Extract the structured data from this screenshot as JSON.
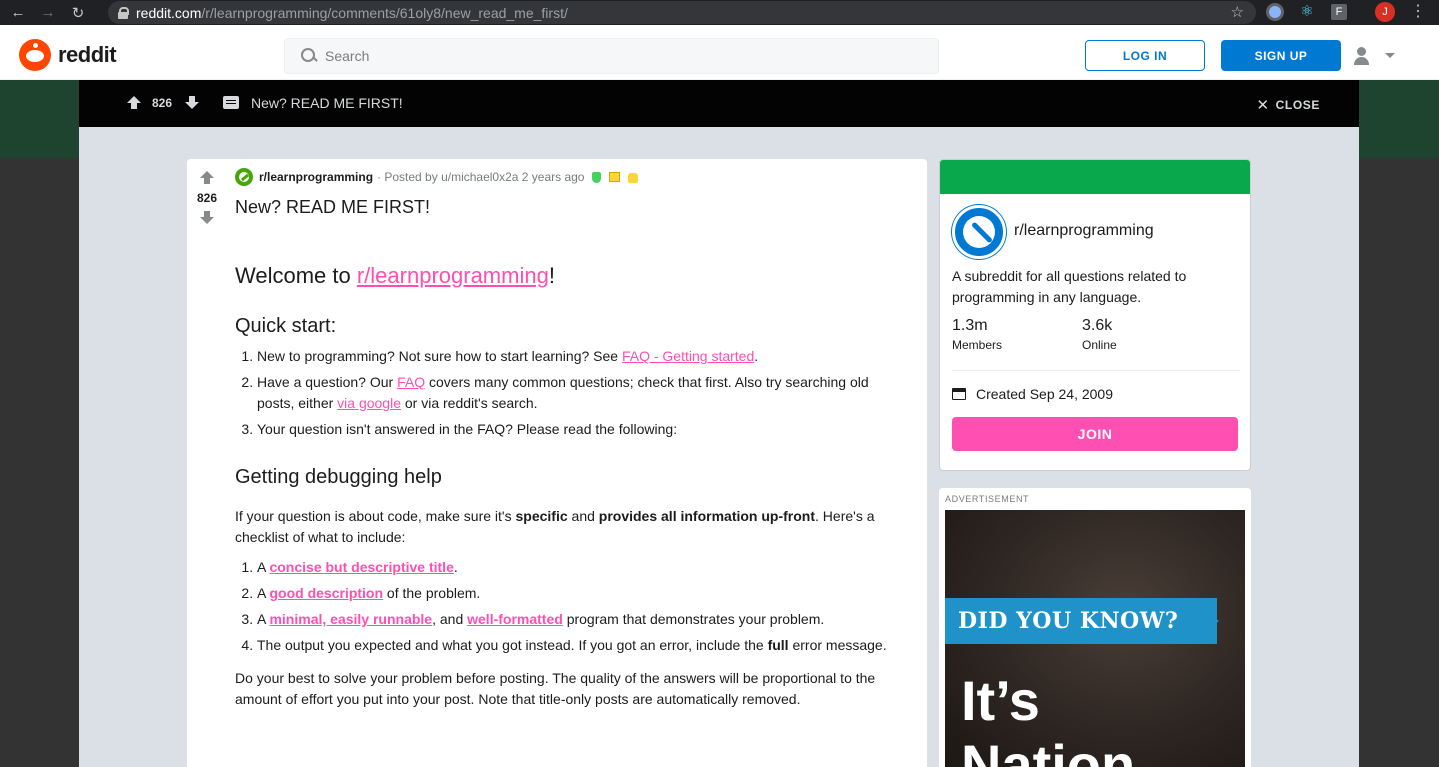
{
  "browser": {
    "url_host": "reddit.com",
    "url_path": "/r/learnprogramming/comments/61oly8/new_read_me_first/",
    "profile_initial": "J",
    "ext_f": "F"
  },
  "header": {
    "logo_text": "reddit",
    "search_placeholder": "Search",
    "login_label": "LOG IN",
    "signup_label": "SIGN UP"
  },
  "topbar": {
    "vote_count": "826",
    "title": "New? READ ME FIRST!",
    "close_label": "CLOSE"
  },
  "post": {
    "vote_count": "826",
    "subreddit": "r/learnprogramming",
    "posted_by": "· Posted by u/michael0x2a 2 years ago",
    "title": "New? READ ME FIRST!",
    "welcome_prefix": "Welcome to ",
    "welcome_link": "r/learnprogramming",
    "welcome_suffix": "!",
    "quick_start_heading": "Quick start:",
    "qs1_text": "New to programming? Not sure how to start learning? See ",
    "qs1_link": "FAQ - Getting started",
    "qs1_end": ".",
    "qs2_text": "Have a question? Our ",
    "qs2_link1": "FAQ",
    "qs2_mid": " covers many common questions; check that first. Also try searching old posts, either ",
    "qs2_link2": "via google",
    "qs2_end": " or via reddit's search.",
    "qs3_text": "Your question isn't answered in the FAQ? Please read the following:",
    "debug_heading": "Getting debugging help",
    "debug_p1_a": "If your question is about code, make sure it's ",
    "debug_p1_b": "specific",
    "debug_p1_c": " and ",
    "debug_p1_d": "provides all information up-front",
    "debug_p1_e": ". Here's a checklist of what to include:",
    "cl1_a": "A ",
    "cl1_link": "concise but descriptive title",
    "cl1_end": ".",
    "cl2_a": "A ",
    "cl2_link": "good description",
    "cl2_end": " of the problem.",
    "cl3_a": "A ",
    "cl3_link1": "minimal, easily runnable",
    "cl3_mid": ", and ",
    "cl3_link2": "well-formatted",
    "cl3_end": " program that demonstrates your problem.",
    "cl4_a": "The output you expected and what you got instead. If you got an error, include the ",
    "cl4_b": "full",
    "cl4_c": " error message.",
    "closing": "Do your best to solve your problem before posting. The quality of the answers will be proportional to the amount of effort you put into your post. Note that title-only posts are automatically removed."
  },
  "sidebar": {
    "name": "r/learnprogramming",
    "description": "A subreddit for all questions related to programming in any language.",
    "members_num": "1.3m",
    "members_label": "Members",
    "online_num": "3.6k",
    "online_label": "Online",
    "created": "Created Sep 24, 2009",
    "join_label": "JOIN"
  },
  "ad": {
    "label": "ADVERTISEMENT",
    "ribbon": "DID YOU KNOW?",
    "big1": "It’s",
    "big2": "Nation"
  }
}
